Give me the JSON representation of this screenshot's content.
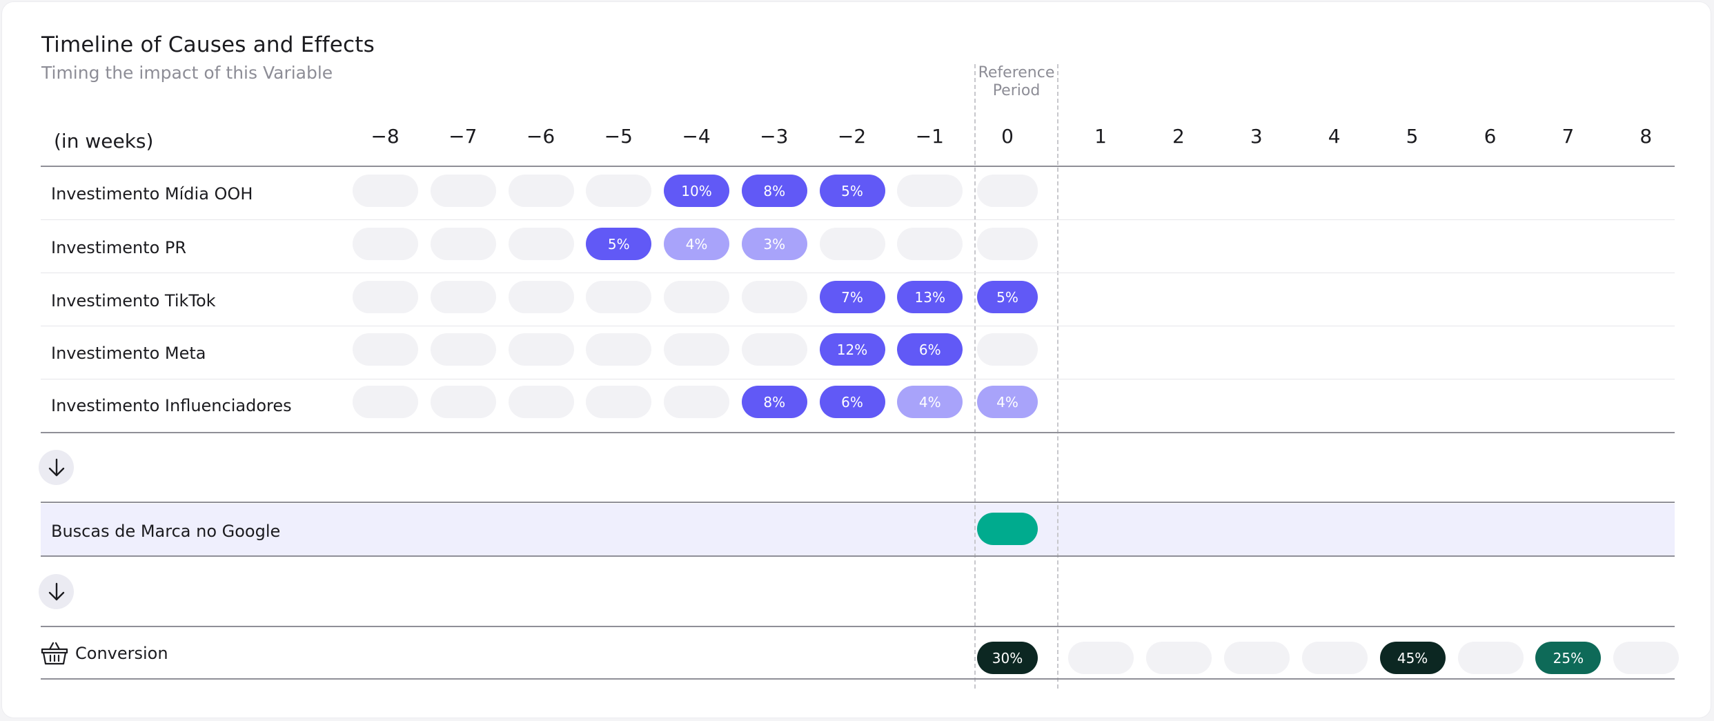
{
  "title": "Timeline of Causes and Effects",
  "subtitle": "Timing the impact of this Variable",
  "reference_label": "Reference Period",
  "unit_label": "(in weeks)",
  "colors": {
    "empty": "#f2f2f5",
    "strong": "#6159f6",
    "light": "#a8a3fa",
    "target": "#00ab8e",
    "conv_dark": "#0c2722",
    "conv_mid": "#0e6a58"
  },
  "icons": {
    "expand": "arrow-down-icon",
    "conversion": "basket-icon"
  },
  "chart_data": {
    "type": "table",
    "weeks": [
      -8,
      -7,
      -6,
      -5,
      -4,
      -3,
      -2,
      -1,
      0,
      1,
      2,
      3,
      4,
      5,
      6,
      7,
      8
    ],
    "week_labels": [
      "−8",
      "−7",
      "−6",
      "−5",
      "−4",
      "−3",
      "−2",
      "−1",
      "0",
      "1",
      "2",
      "3",
      "4",
      "5",
      "6",
      "7",
      "8"
    ],
    "reference_week": 0,
    "causes": [
      {
        "name": "Investimento Mídia OOH",
        "cells": [
          {
            "week": -4,
            "label": "10%",
            "intensity": "strong"
          },
          {
            "week": -3,
            "label": "8%",
            "intensity": "strong"
          },
          {
            "week": -2,
            "label": "5%",
            "intensity": "strong"
          }
        ]
      },
      {
        "name": "Investimento PR",
        "cells": [
          {
            "week": -5,
            "label": "5%",
            "intensity": "strong"
          },
          {
            "week": -4,
            "label": "4%",
            "intensity": "light"
          },
          {
            "week": -3,
            "label": "3%",
            "intensity": "light"
          }
        ]
      },
      {
        "name": "Investimento TikTok",
        "cells": [
          {
            "week": -2,
            "label": "7%",
            "intensity": "strong"
          },
          {
            "week": -1,
            "label": "13%",
            "intensity": "strong"
          },
          {
            "week": 0,
            "label": "5%",
            "intensity": "strong"
          }
        ]
      },
      {
        "name": "Investimento Meta",
        "cells": [
          {
            "week": -2,
            "label": "12%",
            "intensity": "strong"
          },
          {
            "week": -1,
            "label": "6%",
            "intensity": "strong"
          }
        ]
      },
      {
        "name": "Investimento Influenciadores",
        "cells": [
          {
            "week": -3,
            "label": "8%",
            "intensity": "strong"
          },
          {
            "week": -2,
            "label": "6%",
            "intensity": "strong"
          },
          {
            "week": -1,
            "label": "4%",
            "intensity": "light"
          },
          {
            "week": 0,
            "label": "4%",
            "intensity": "light"
          }
        ]
      }
    ],
    "target": {
      "name": "Buscas de Marca no Google",
      "week": 0
    },
    "conversion": {
      "name": "Conversion",
      "cells": [
        {
          "week": 0,
          "label": "30%",
          "intensity": "dark"
        },
        {
          "week": 5,
          "label": "45%",
          "intensity": "dark"
        },
        {
          "week": 7,
          "label": "25%",
          "intensity": "mid"
        }
      ]
    }
  }
}
